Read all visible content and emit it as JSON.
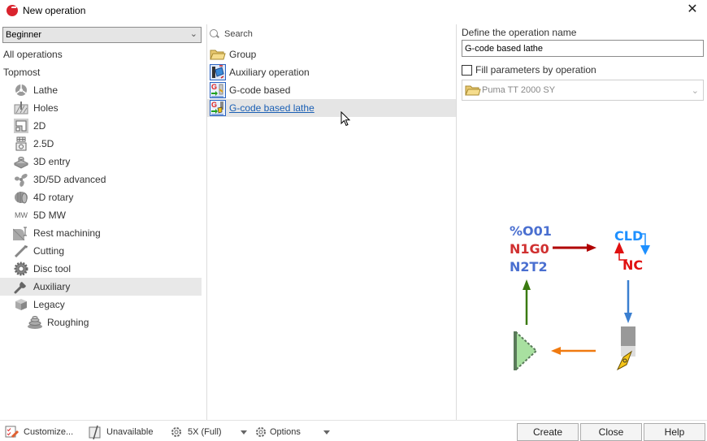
{
  "window": {
    "title": "New operation",
    "close_label": "✕"
  },
  "left_panel": {
    "level_select": {
      "value": "Beginner"
    },
    "all_operations": "All operations",
    "topmost": "Topmost",
    "categories": [
      {
        "label": "Lathe",
        "icon": "lathe-icon"
      },
      {
        "label": "Holes",
        "icon": "holes-icon"
      },
      {
        "label": "2D",
        "icon": "2d-icon"
      },
      {
        "label": "2.5D",
        "icon": "2-5d-icon"
      },
      {
        "label": "3D entry",
        "icon": "3d-entry-icon"
      },
      {
        "label": "3D/5D advanced",
        "icon": "fan-icon"
      },
      {
        "label": "4D rotary",
        "icon": "rotary-icon"
      },
      {
        "label": "5D MW",
        "icon": "mw-icon",
        "icon_text": "MW"
      },
      {
        "label": "Rest machining",
        "icon": "rest-machining-icon"
      },
      {
        "label": "Cutting",
        "icon": "cutting-icon"
      },
      {
        "label": "Disc tool",
        "icon": "disc-tool-icon"
      },
      {
        "label": "Auxiliary",
        "icon": "wrench-icon",
        "selected": true
      },
      {
        "label": "Legacy",
        "icon": "legacy-icon"
      },
      {
        "label": "Roughing",
        "icon": "roughing-icon",
        "indent": true
      }
    ]
  },
  "middle_panel": {
    "search_placeholder": "Search",
    "operations": [
      {
        "label": "Group",
        "icon": "folder-icon"
      },
      {
        "label": "Auxiliary operation",
        "icon": "auxiliary-operation-icon"
      },
      {
        "label": "G-code based",
        "icon": "gcode-icon"
      },
      {
        "label": "G-code based lathe",
        "icon": "gcode-lathe-icon",
        "selected": true
      }
    ]
  },
  "right_panel": {
    "define_label": "Define the operation name",
    "name_value": "G-code based lathe",
    "fill_label": "Fill parameters by operation",
    "fill_checked": false,
    "machine_value": "Puma TT 2000 SY",
    "diagram": {
      "code_lines": [
        "%O01",
        "N1G0",
        "N2T2"
      ],
      "cld_label": "CLD",
      "nc_label": "NC"
    }
  },
  "bottom_bar": {
    "customize": "Customize...",
    "unavailable": "Unavailable",
    "mode": "5X (Full)",
    "options": "Options",
    "create": "Create",
    "close": "Close",
    "help": "Help"
  },
  "colors": {
    "code_blue": "#4a6fd0",
    "code_red": "#d03030",
    "arrow_red": "#b00000",
    "arrow_blue": "#3a7fd0",
    "arrow_green": "#3a7a10",
    "arrow_orange": "#f07a10",
    "cld_blue": "#1e90ff",
    "nc_red": "#e01010",
    "link_blue": "#1a5fb4",
    "selected_bg": "#e8e8e8"
  }
}
